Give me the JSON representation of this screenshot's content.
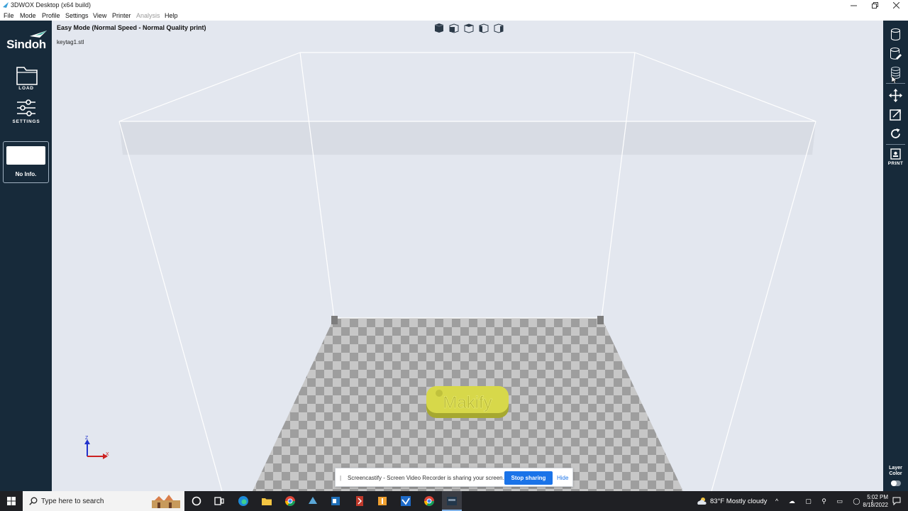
{
  "window": {
    "title": "3DWOX Desktop (x64 build)"
  },
  "menu": {
    "items": [
      {
        "label": "File",
        "disabled": false
      },
      {
        "label": "Mode",
        "disabled": false
      },
      {
        "label": "Profile",
        "disabled": false
      },
      {
        "label": "Settings",
        "disabled": false
      },
      {
        "label": "View",
        "disabled": false
      },
      {
        "label": "Printer",
        "disabled": false
      },
      {
        "label": "Analysis",
        "disabled": true
      },
      {
        "label": "Help",
        "disabled": false
      }
    ]
  },
  "sidebar": {
    "logo": "Sindoh",
    "load_label": "LOAD",
    "settings_label": "SETTINGS",
    "info_text": "No Info."
  },
  "viewport": {
    "mode_title": "Easy Mode (Normal Speed - Normal Quality print)",
    "filename": "keytag1.stl",
    "axis_z": "Z",
    "axis_x": "X",
    "model_text": "Makify",
    "model_color": "#d7d84a"
  },
  "rightbar": {
    "print_label": "PRINT",
    "layer_color_label_1": "Layer",
    "layer_color_label_2": "Color"
  },
  "share_banner": {
    "message": "Screencastify - Screen Video Recorder is sharing your screen.",
    "stop_label": "Stop sharing",
    "hide_label": "Hide"
  },
  "taskbar": {
    "search_placeholder": "Type here to search",
    "weather": "83°F  Mostly cloudy",
    "time": "5:02 PM",
    "date": "8/18/2022"
  },
  "colors": {
    "sidebar_bg": "#172a3a",
    "viewport_bg": "#e3e7ef",
    "accent_blue": "#1a73e8"
  }
}
